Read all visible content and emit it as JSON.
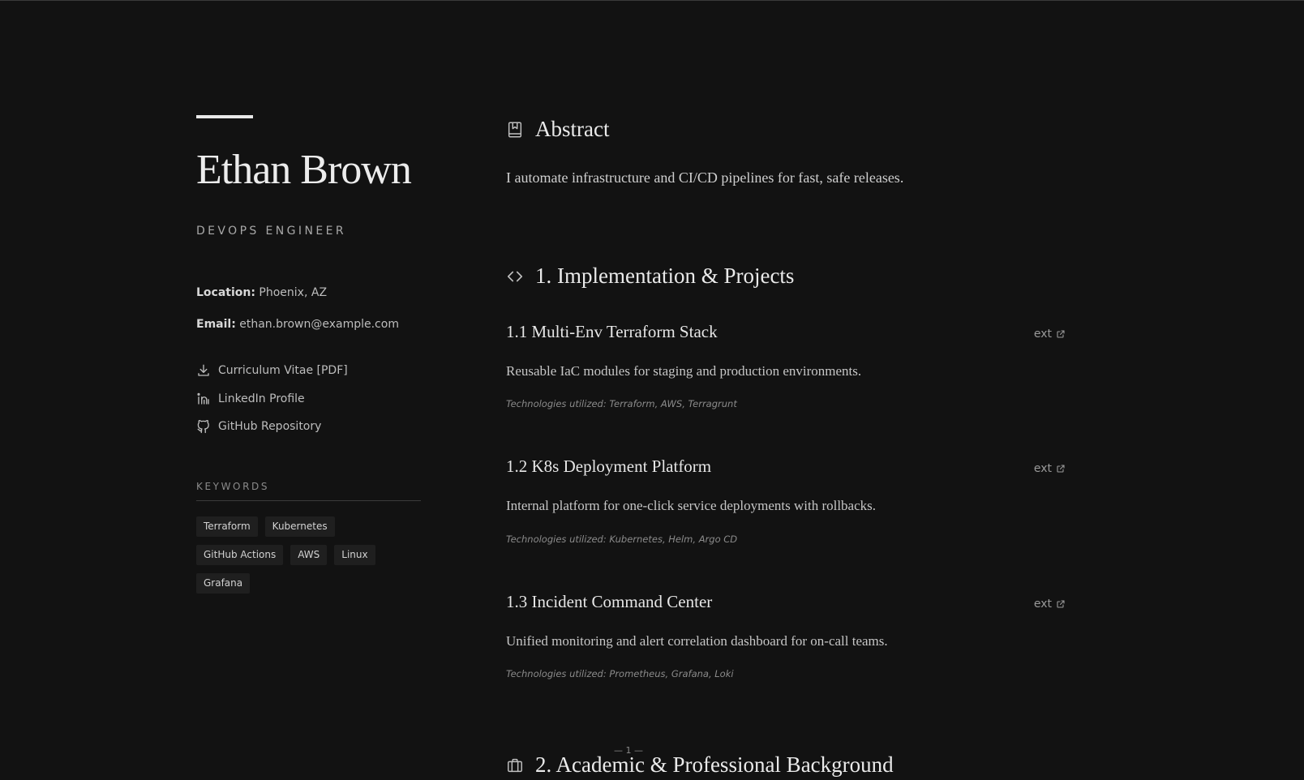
{
  "profile": {
    "name": "Ethan Brown",
    "role": "DEVOPS ENGINEER",
    "location_label": "Location:",
    "location": "Phoenix, AZ",
    "email_label": "Email:",
    "email": "ethan.brown@example.com"
  },
  "links": [
    {
      "label": "Curriculum Vitae [PDF]",
      "icon": "download-icon"
    },
    {
      "label": "LinkedIn Profile",
      "icon": "linkedin-icon"
    },
    {
      "label": "GitHub Repository",
      "icon": "github-icon"
    }
  ],
  "keywords": {
    "heading": "KEYWORDS",
    "tags": [
      "Terraform",
      "Kubernetes",
      "GitHub Actions",
      "AWS",
      "Linux",
      "Grafana"
    ]
  },
  "abstract": {
    "heading": "Abstract",
    "icon": "bookmark-icon",
    "text": "I automate infrastructure and CI/CD pipelines for fast, safe releases."
  },
  "projects_section": {
    "heading": "1. Implementation & Projects",
    "icon": "code-icon",
    "ext_label": "ext",
    "items": [
      {
        "title": "1.1 Multi-Env Terraform Stack",
        "description": "Reusable IaC modules for staging and production environments.",
        "tech": "Technologies utilized: Terraform, AWS, Terragrunt"
      },
      {
        "title": "1.2 K8s Deployment Platform",
        "description": "Internal platform for one-click service deployments with rollbacks.",
        "tech": "Technologies utilized: Kubernetes, Helm, Argo CD"
      },
      {
        "title": "1.3 Incident Command Center",
        "description": "Unified monitoring and alert correlation dashboard for on-call teams.",
        "tech": "Technologies utilized: Prometheus, Grafana, Loki"
      }
    ]
  },
  "background_section": {
    "heading": "2. Academic & Professional Background",
    "icon": "briefcase-icon"
  },
  "page_number": "— 1 —",
  "colors": {
    "background": "#121212",
    "text": "#e6e6e6",
    "muted": "#8a8a8a",
    "tag_bg": "#1f1f1f"
  }
}
